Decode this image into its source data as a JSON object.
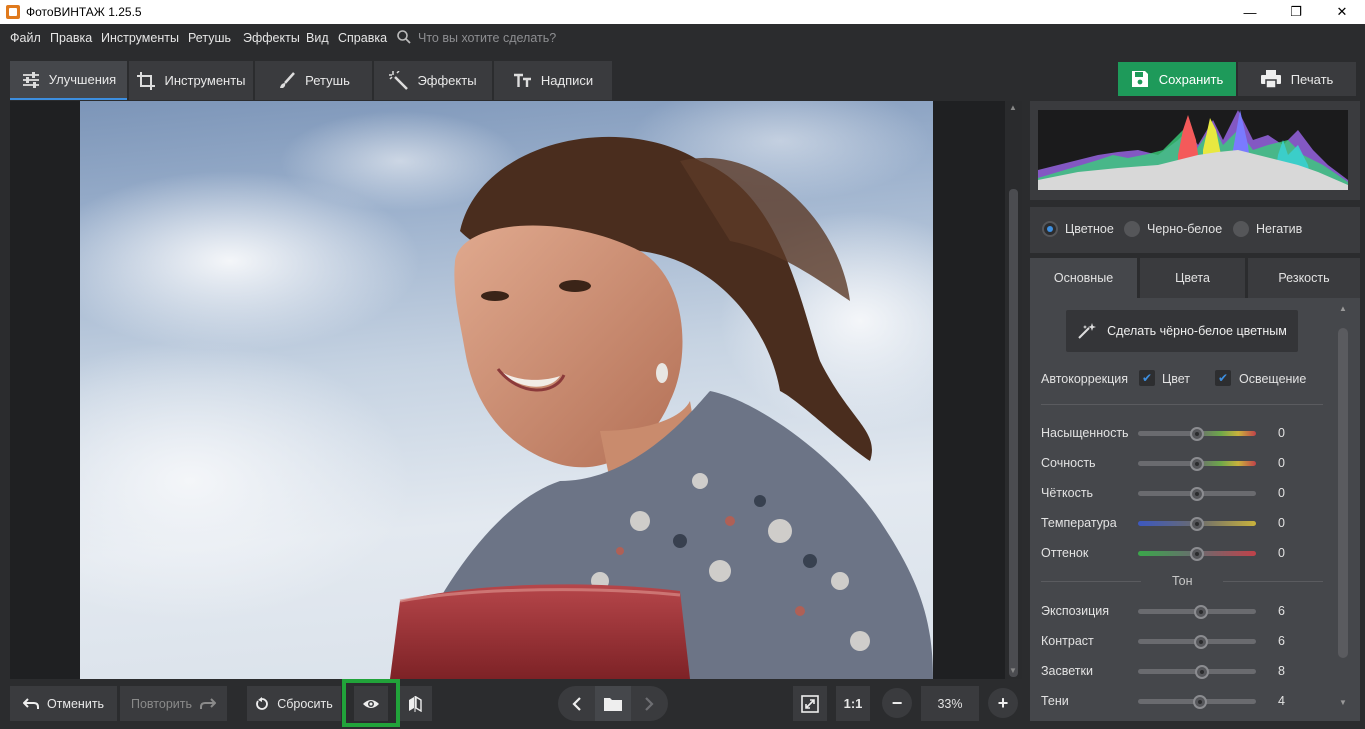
{
  "window": {
    "title": "ФотоВИНТАЖ 1.25.5",
    "minimize": "—",
    "maximize": "❐",
    "close": "✕"
  },
  "menu": {
    "items": [
      "Файл",
      "Правка",
      "Инструменты",
      "Ретушь",
      "Эффекты",
      "Вид",
      "Справка"
    ],
    "search_placeholder": "Что вы хотите сделать?"
  },
  "tabs": [
    {
      "label": "Улучшения",
      "icon": "sliders-icon",
      "active": true
    },
    {
      "label": "Инструменты",
      "icon": "crop-icon"
    },
    {
      "label": "Ретушь",
      "icon": "brush-icon"
    },
    {
      "label": "Эффекты",
      "icon": "magic-wand-icon"
    },
    {
      "label": "Надписи",
      "icon": "text-icon"
    }
  ],
  "actions": {
    "save": "Сохранить",
    "print": "Печать"
  },
  "color_mode": {
    "options": [
      "Цветное",
      "Черно-белое",
      "Негатив"
    ],
    "selected": "Цветное"
  },
  "subtabs": [
    {
      "label": "Основные",
      "active": true
    },
    {
      "label": "Цвета"
    },
    {
      "label": "Резкость"
    }
  ],
  "settings": {
    "bw_to_color_button": "Сделать чёрно-белое цветным",
    "autocorrection_label": "Автокоррекция",
    "auto_color": {
      "label": "Цвет",
      "checked": true
    },
    "auto_light": {
      "label": "Освещение",
      "checked": true
    },
    "color_sliders": [
      {
        "label": "Насыщенность",
        "value": "0"
      },
      {
        "label": "Сочность",
        "value": "0"
      },
      {
        "label": "Чёткость",
        "value": "0"
      },
      {
        "label": "Температура",
        "value": "0"
      },
      {
        "label": "Оттенок",
        "value": "0"
      }
    ],
    "tone_section": "Тон",
    "tone_sliders": [
      {
        "label": "Экспозиция",
        "value": "6"
      },
      {
        "label": "Контраст",
        "value": "6"
      },
      {
        "label": "Засветки",
        "value": "8"
      },
      {
        "label": "Тени",
        "value": "4"
      }
    ]
  },
  "bottom": {
    "undo": "Отменить",
    "redo": "Повторить",
    "reset": "Сбросить",
    "zoom_1to1": "1:1",
    "zoom_level": "33%"
  },
  "colors": {
    "accent": "#3d8fe0",
    "save_green": "#1e9a5a",
    "highlight_green": "#21a33a"
  }
}
